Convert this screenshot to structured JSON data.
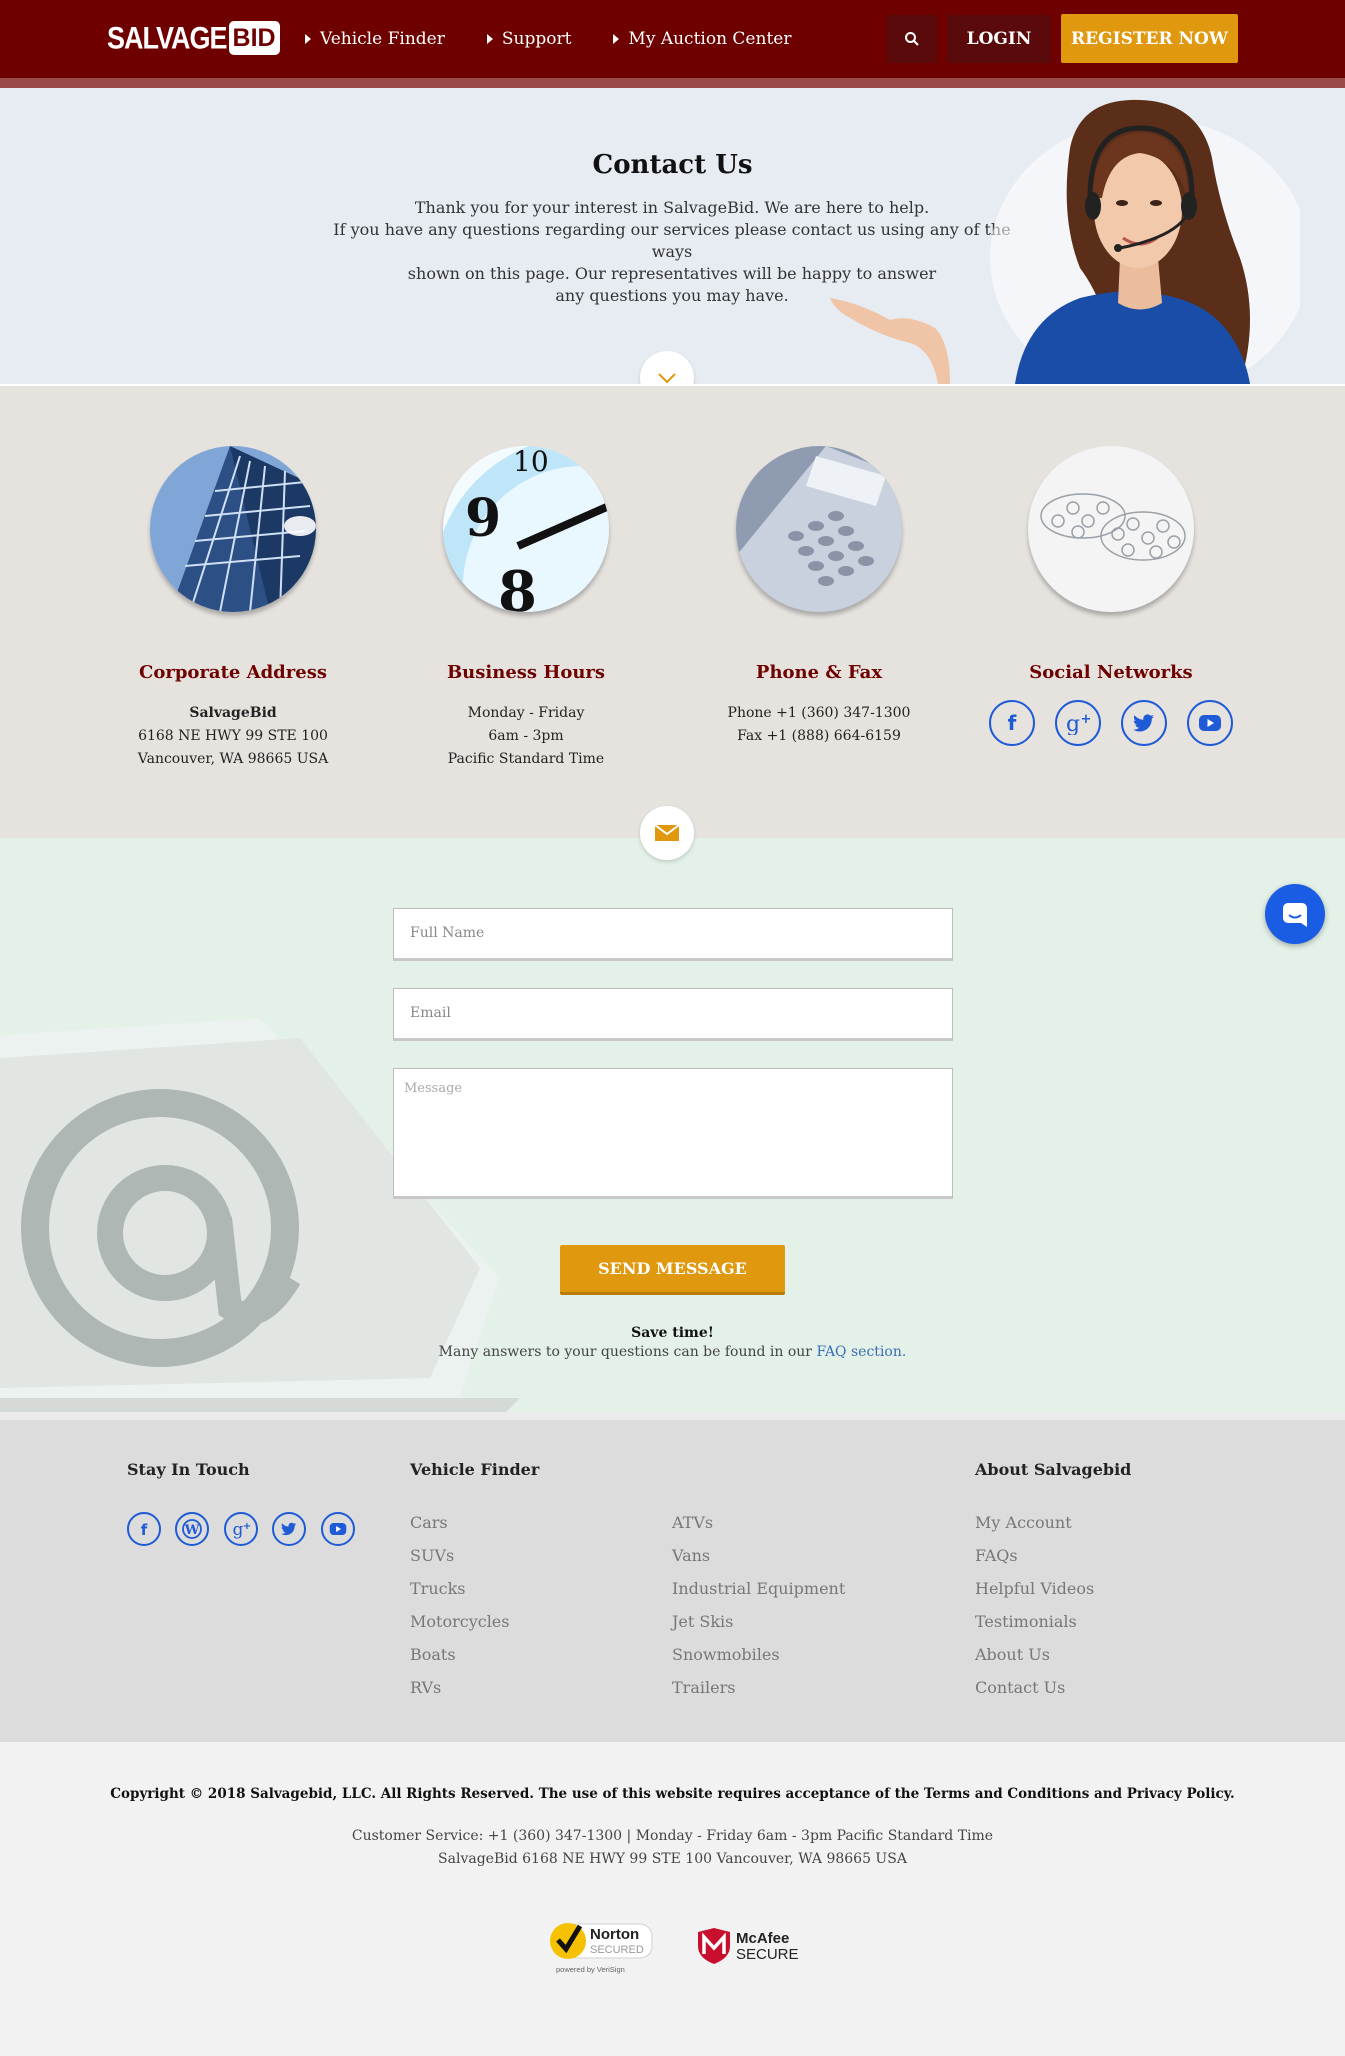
{
  "header": {
    "logo_part1": "SALVAGE",
    "logo_part2": "BID",
    "nav": [
      "Vehicle Finder",
      "Support",
      "My Auction Center"
    ],
    "login_label": "LOGIN",
    "register_label": "REGISTER NOW"
  },
  "hero": {
    "title": "Contact Us",
    "line1": "Thank you for your interest in SalvageBid. We are here to help.",
    "line2": "If you have any questions regarding our services please contact us using any of the ways",
    "line3": "shown on this page. Our representatives will be happy to answer",
    "line4": "any questions you may have."
  },
  "info": {
    "address": {
      "title": "Corporate Address",
      "name": "SalvageBid",
      "street": "6168 NE HWY 99 STE 100",
      "city": "Vancouver, WA 98665 USA"
    },
    "hours": {
      "title": "Business Hours",
      "days": "Monday - Friday",
      "time": "6am - 3pm",
      "zone": "Pacific Standard Time"
    },
    "phone": {
      "title": "Phone & Fax",
      "phone": "Phone +1 (360) 347-1300",
      "fax": "Fax +1 (888) 664-6159"
    },
    "social": {
      "title": "Social Networks",
      "icons": [
        "facebook-icon",
        "google-plus-icon",
        "twitter-icon",
        "youtube-icon"
      ]
    }
  },
  "form": {
    "name_placeholder": "Full Name",
    "email_placeholder": "Email",
    "message_placeholder": "Message",
    "send_label": "SEND MESSAGE",
    "save_title": "Save time!",
    "save_text": "Many answers to your questions can be found in our",
    "faq_link": "FAQ section."
  },
  "footer": {
    "stay_title": "Stay In Touch",
    "finder_title": "Vehicle Finder",
    "about_title": "About Salvagebid",
    "finder_col1": [
      "Cars",
      "SUVs",
      "Trucks",
      "Motorcycles",
      "Boats",
      "RVs"
    ],
    "finder_col2": [
      "ATVs",
      "Vans",
      "Industrial Equipment",
      "Jet Skis",
      "Snowmobiles",
      "Trailers"
    ],
    "about_links": [
      "My Account",
      "FAQs",
      "Helpful Videos",
      "Testimonials",
      "About Us",
      "Contact Us"
    ],
    "social_icons": [
      "facebook-icon",
      "wordpress-icon",
      "google-plus-icon",
      "twitter-icon",
      "youtube-icon"
    ]
  },
  "bottom": {
    "copyright": "Copyright © 2018 Salvagebid, LLC. All Rights Reserved. The use of this website requires acceptance of the Terms and Conditions and Privacy Policy.",
    "service_line": "Customer Service: +1 (360) 347-1300  |  Monday - Friday 6am - 3pm Pacific Standard Time",
    "address_line": "SalvageBid 6168 NE HWY 99 STE 100 Vancouver, WA 98665 USA",
    "norton_brand": "Norton",
    "norton_secured": "SECURED",
    "norton_powered": "powered by VeriSign",
    "mcafee_brand": "McAfee",
    "mcafee_secure": "SECURE"
  },
  "colors": {
    "brand": "#6e0000",
    "accent": "#e0990e",
    "social": "#1f5bd6"
  }
}
